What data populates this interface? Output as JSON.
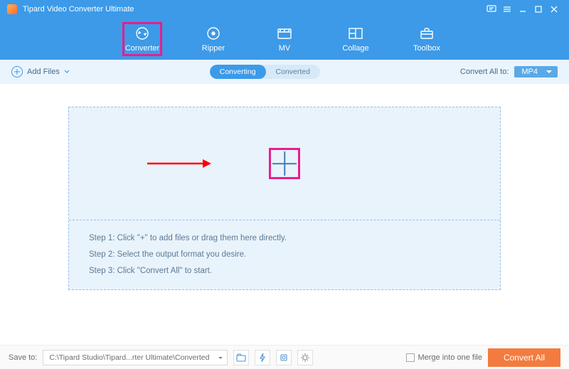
{
  "app": {
    "title": "Tipard Video Converter Ultimate"
  },
  "nav": {
    "converter": "Converter",
    "ripper": "Ripper",
    "mv": "MV",
    "collage": "Collage",
    "toolbox": "Toolbox"
  },
  "subbar": {
    "add_files": "Add Files",
    "seg_converting": "Converting",
    "seg_converted": "Converted",
    "convert_all_to": "Convert All to:",
    "format": "MP4"
  },
  "steps": {
    "s1": "Step 1: Click \"+\" to add files or drag them here directly.",
    "s2": "Step 2: Select the output format you desire.",
    "s3": "Step 3: Click \"Convert All\" to start."
  },
  "bottom": {
    "save_to": "Save to:",
    "path": "C:\\Tipard Studio\\Tipard...rter Ultimate\\Converted",
    "merge": "Merge into one file",
    "convert_all": "Convert All"
  }
}
